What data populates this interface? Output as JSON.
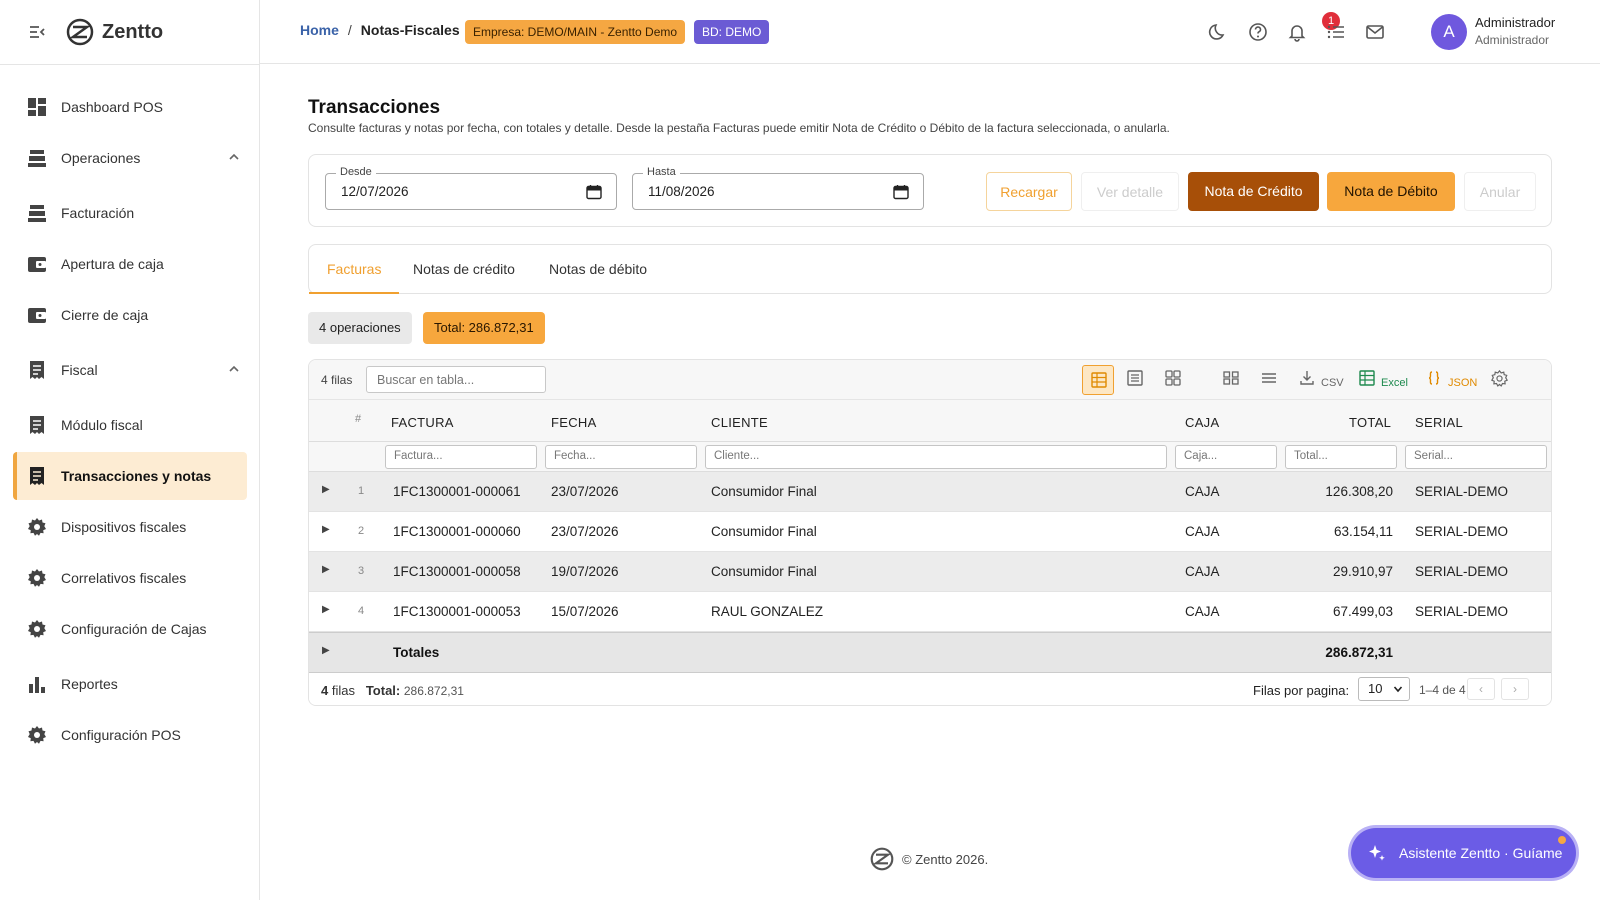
{
  "app": {
    "name": "Zentto",
    "copyright": "© Zentto 2026."
  },
  "sidebar": {
    "items": [
      {
        "label": "Dashboard POS"
      },
      {
        "label": "Operaciones"
      },
      {
        "label": "Facturación"
      },
      {
        "label": "Apertura de caja"
      },
      {
        "label": "Cierre de caja"
      },
      {
        "label": "Fiscal"
      },
      {
        "label": "Módulo fiscal"
      },
      {
        "label": "Transacciones y notas"
      },
      {
        "label": "Dispositivos fiscales"
      },
      {
        "label": "Correlativos fiscales"
      },
      {
        "label": "Configuración de Cajas"
      },
      {
        "label": "Reportes"
      },
      {
        "label": "Configuración POS"
      }
    ]
  },
  "topbar": {
    "breadcrumb": {
      "home": "Home",
      "sep": "/",
      "current": "Notas-Fiscales"
    },
    "empresa_chip": "Empresa: DEMO/MAIN - Zentto Demo",
    "bd_chip": "BD: DEMO",
    "notifications_count": "1",
    "user": {
      "initial": "A",
      "name": "Administrador",
      "role": "Administrador"
    }
  },
  "page": {
    "title": "Transacciones",
    "subtitle": "Consulte facturas y notas por fecha, con totales y detalle. Desde la pestaña Facturas puede emitir Nota de Crédito o Débito de la factura seleccionada, o anularla."
  },
  "filters": {
    "desde": {
      "label": "Desde",
      "value": "12/07/2026"
    },
    "hasta": {
      "label": "Hasta",
      "value": "11/08/2026"
    },
    "buttons": {
      "recargar": "Recargar",
      "ver_detalle": "Ver detalle",
      "nota_credito": "Nota de Crédito",
      "nota_debito": "Nota de Débito",
      "anular": "Anular"
    }
  },
  "tabs": [
    {
      "label": "Facturas",
      "active": true
    },
    {
      "label": "Notas de crédito"
    },
    {
      "label": "Notas de débito"
    }
  ],
  "summary": {
    "operaciones": "4 operaciones",
    "total": "Total: 286.872,31"
  },
  "grid": {
    "rows_label": "4 filas",
    "search_placeholder": "Buscar en tabla...",
    "toolbar": {
      "csv": "CSV",
      "excel": "Excel",
      "json": "JSON"
    },
    "columns": {
      "index": "#",
      "factura": "FACTURA",
      "fecha": "FECHA",
      "cliente": "CLIENTE",
      "caja": "CAJA",
      "total": "TOTAL",
      "serial": "SERIAL"
    },
    "filter_placeholders": {
      "factura": "Factura...",
      "fecha": "Fecha...",
      "cliente": "Cliente...",
      "caja": "Caja...",
      "total": "Total...",
      "serial": "Serial..."
    },
    "rows": [
      {
        "index": "1",
        "factura": "1FC1300001-000061",
        "fecha": "23/07/2026",
        "cliente": "Consumidor Final",
        "caja": "CAJA",
        "total": "126.308,20",
        "serial": "SERIAL-DEMO"
      },
      {
        "index": "2",
        "factura": "1FC1300001-000060",
        "fecha": "23/07/2026",
        "cliente": "Consumidor Final",
        "caja": "CAJA",
        "total": "63.154,11",
        "serial": "SERIAL-DEMO"
      },
      {
        "index": "3",
        "factura": "1FC1300001-000058",
        "fecha": "19/07/2026",
        "cliente": "Consumidor Final",
        "caja": "CAJA",
        "total": "29.910,97",
        "serial": "SERIAL-DEMO"
      },
      {
        "index": "4",
        "factura": "1FC1300001-000053",
        "fecha": "15/07/2026",
        "cliente": "RAUL GONZALEZ",
        "caja": "CAJA",
        "total": "67.499,03",
        "serial": "SERIAL-DEMO"
      }
    ],
    "totals": {
      "label": "Totales",
      "value": "286.872,31"
    },
    "footer": {
      "filas_count": "4",
      "filas_word": "filas",
      "total_label": "Total:",
      "total_value": "286.872,31",
      "per_page_label": "Filas por pagina:",
      "per_page_value": "10",
      "range": "1–4 de 4"
    }
  },
  "assistant": {
    "label": "Asistente Zentto · Guíame"
  },
  "colors": {
    "accent": "#f0a030",
    "primary": "#6b5ce6",
    "credito": "#a74f08",
    "debito": "#f7a73d"
  }
}
